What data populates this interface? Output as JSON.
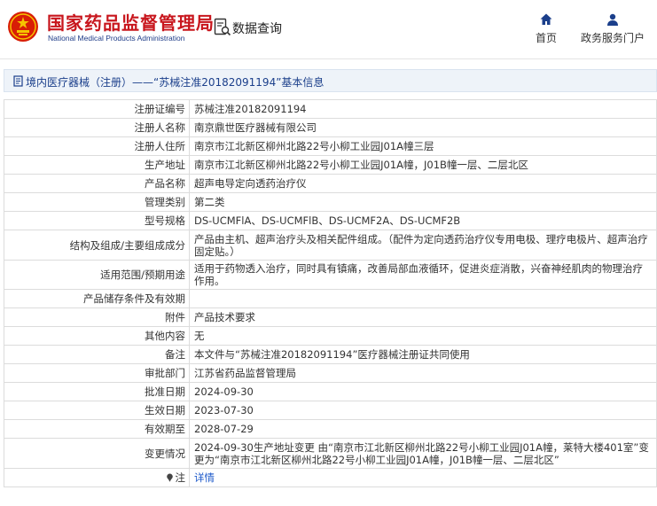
{
  "header": {
    "logo_cn": "国家药品监督管理局",
    "logo_en": "National Medical Products Administration",
    "query_label": "数据查询",
    "nav": [
      {
        "label": "首页",
        "icon": "home-icon"
      },
      {
        "label": "政务服务门户",
        "icon": "user-icon"
      }
    ]
  },
  "title_bar": {
    "text": "境内医疗器械（注册）——“苏械注准20182091194”基本信息"
  },
  "rows": [
    {
      "label": "注册证编号",
      "value": "苏械注准20182091194"
    },
    {
      "label": "注册人名称",
      "value": "南京鼎世医疗器械有限公司"
    },
    {
      "label": "注册人住所",
      "value": "南京市江北新区柳州北路22号小柳工业园J01A幢三层"
    },
    {
      "label": "生产地址",
      "value": "南京市江北新区柳州北路22号小柳工业园J01A幢，J01B幢一层、二层北区"
    },
    {
      "label": "产品名称",
      "value": "超声电导定向透药治疗仪"
    },
    {
      "label": "管理类别",
      "value": "第二类"
    },
    {
      "label": "型号规格",
      "value": "DS-UCMFlA、DS-UCMFlB、DS-UCMF2A、DS-UCMF2B"
    },
    {
      "label": "结构及组成/主要组成成分",
      "value": "产品由主机、超声治疗头及相关配件组成。（配件为定向透药治疗仪专用电极、理疗电极片、超声治疗固定贴。）"
    },
    {
      "label": "适用范围/预期用途",
      "value": "适用于药物透入治疗，同时具有镇痛，改善局部血液循环，促进炎症消散，兴奋神经肌肉的物理治疗作用。"
    },
    {
      "label": "产品储存条件及有效期",
      "value": ""
    },
    {
      "label": "附件",
      "value": "产品技术要求"
    },
    {
      "label": "其他内容",
      "value": "无"
    },
    {
      "label": "备注",
      "value": "本文件与“苏械注准20182091194”医疗器械注册证共同使用"
    },
    {
      "label": "审批部门",
      "value": "江苏省药品监督管理局"
    },
    {
      "label": "批准日期",
      "value": "2024-09-30"
    },
    {
      "label": "生效日期",
      "value": "2023-07-30"
    },
    {
      "label": "有效期至",
      "value": "2028-07-29"
    },
    {
      "label": "变更情况",
      "value": "2024-09-30生产地址变更 由“南京市江北新区柳州北路22号小柳工业园J01A幢，莱特大楼401室”变更为“南京市江北新区柳州北路22号小柳工业园J01A幢，J01B幢一层、二层北区”"
    }
  ],
  "note": {
    "label": "注",
    "link": "详情"
  },
  "colors": {
    "brand_red": "#c8161d",
    "nav_blue": "#1b3f8b",
    "link_blue": "#1a57c9"
  }
}
